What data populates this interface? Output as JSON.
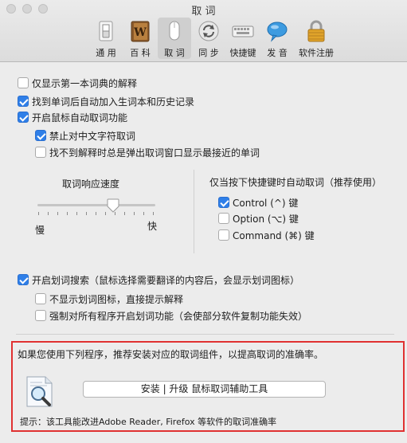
{
  "window": {
    "title": "取 词"
  },
  "toolbar": {
    "items": [
      {
        "label": "通 用",
        "icon": "general-switch-icon"
      },
      {
        "label": "百 科",
        "icon": "encyclopedia-book-icon"
      },
      {
        "label": "取 词",
        "icon": "mouse-icon",
        "active": true
      },
      {
        "label": "同 步",
        "icon": "sync-icon"
      },
      {
        "label": "快捷键",
        "icon": "keyboard-icon"
      },
      {
        "label": "发 音",
        "icon": "speech-bubble-icon"
      },
      {
        "label": "软件注册",
        "icon": "padlock-icon"
      }
    ]
  },
  "options": {
    "first_dict_only": {
      "label": "仅显示第一本词典的解释",
      "checked": false
    },
    "auto_add_wordbook": {
      "label": "找到单词后自动加入生词本和历史记录",
      "checked": true
    },
    "mouse_lookup": {
      "label": "开启鼠标自动取词功能",
      "checked": true
    },
    "no_chinese": {
      "label": "禁止对中文字符取词",
      "checked": true
    },
    "popup_nearest": {
      "label": "找不到解释时总是弹出取词窗口显示最接近的单词",
      "checked": false
    }
  },
  "speed": {
    "title": "取词响应速度",
    "slow": "慢",
    "fast": "快",
    "value_percent": 64
  },
  "hotkey": {
    "title": "仅当按下快捷键时自动取词（推荐使用）",
    "control": {
      "label": "Control (^) 键",
      "checked": true
    },
    "option": {
      "label": "Option (⌥) 键",
      "checked": false
    },
    "command": {
      "label": "Command (⌘) 键",
      "checked": false
    }
  },
  "selection": {
    "enable": {
      "label": "开启划词搜索（鼠标选择需要翻译的内容后，会显示划词图标）",
      "checked": true
    },
    "no_icon": {
      "label": "不显示划词图标，直接提示解释",
      "checked": false
    },
    "force_all": {
      "label": "强制对所有程序开启划词功能（会使部分软件复制功能失效）",
      "checked": false
    }
  },
  "helper": {
    "intro": "如果您使用下列程序，推荐安装对应的取词组件，以提高取词的准确率。",
    "button": "安装 | 升级  鼠标取词辅助工具",
    "hint": "提示：该工具能改进Adobe Reader, Firefox 等软件的取词准确率"
  },
  "colors": {
    "accent": "#2f7fe8",
    "highlight_border": "#e03131"
  }
}
